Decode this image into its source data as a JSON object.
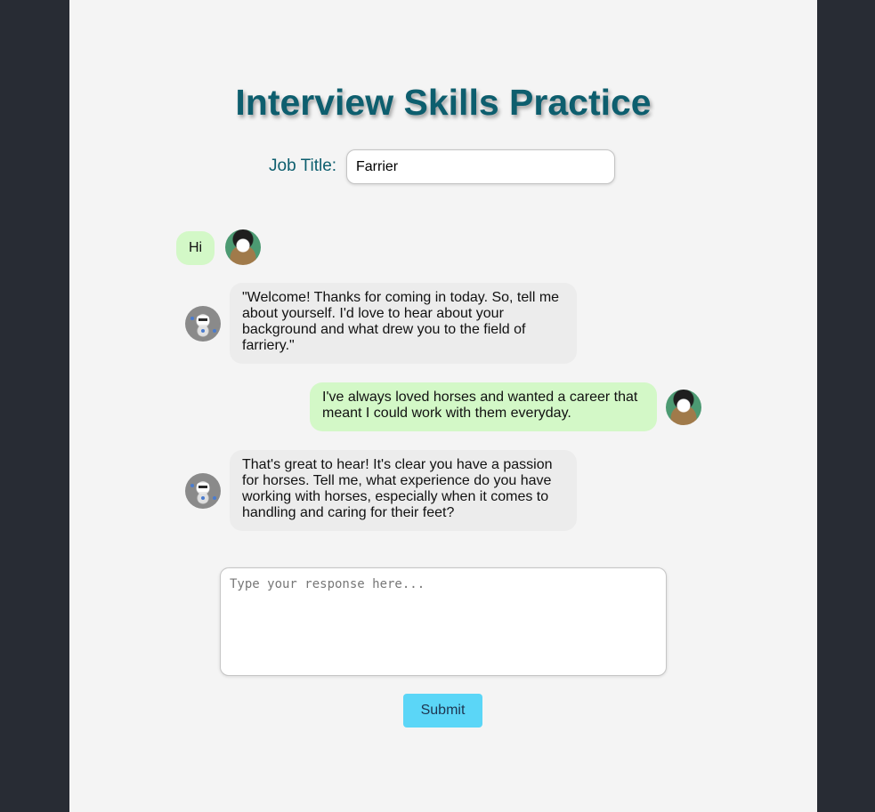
{
  "header": {
    "title": "Interview Skills Practice"
  },
  "job": {
    "label": "Job Title:",
    "value": "Farrier"
  },
  "messages": [
    {
      "role": "user",
      "text": "Hi",
      "avatar": "cat-photo-icon"
    },
    {
      "role": "bot",
      "text": "\"Welcome! Thanks for coming in today. So, tell me about yourself. I'd love to hear about your background and what drew you to the field of farriery.\"",
      "avatar": "robot-icon"
    },
    {
      "role": "user",
      "text": "I've always loved horses and wanted a career that meant I could work with them everyday.",
      "avatar": "cat-photo-icon"
    },
    {
      "role": "bot",
      "text": "That's great to hear! It's clear you have a passion for horses. Tell me, what experience do you have working with horses, especially when it comes to handling and caring for their feet?",
      "avatar": "robot-icon"
    }
  ],
  "response": {
    "placeholder": "Type your response here...",
    "value": ""
  },
  "submit": {
    "label": "Submit"
  },
  "colors": {
    "background": "#282c34",
    "panel": "#f4f4f4",
    "title": "#0d5e6e",
    "user_bubble": "#d3f8c7",
    "bot_bubble": "#ececec",
    "submit": "#5bd6f7"
  }
}
